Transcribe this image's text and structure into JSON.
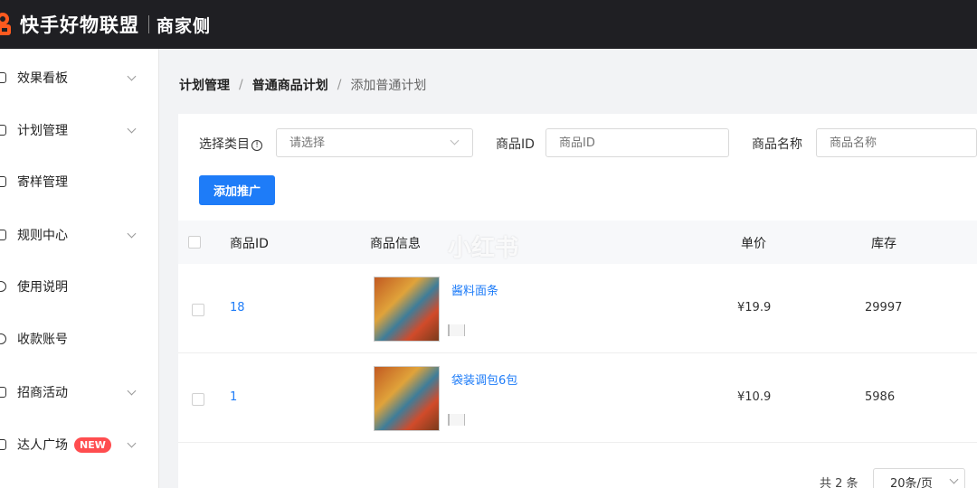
{
  "header": {
    "brand": "快手好物联盟",
    "subtitle": "商家侧"
  },
  "sidebar": {
    "items": [
      {
        "label": "效果看板",
        "icon": "chart-icon"
      },
      {
        "label": "计划管理",
        "icon": "plan-icon"
      },
      {
        "label": "寄样管理",
        "icon": "sample-icon"
      },
      {
        "label": "规则中心",
        "icon": "rules-icon"
      },
      {
        "label": "使用说明",
        "icon": "help-icon"
      },
      {
        "label": "收款账号",
        "icon": "account-icon"
      },
      {
        "label": "招商活动",
        "icon": "activity-icon"
      },
      {
        "label": "达人广场",
        "icon": "creator-icon",
        "badge": "NEW"
      }
    ]
  },
  "breadcrumb": [
    "计划管理",
    "普通商品计划",
    "添加普通计划"
  ],
  "filters": {
    "category_label": "选择类目",
    "category_placeholder": "请选择",
    "product_id_label": "商品ID",
    "product_id_placeholder": "商品ID",
    "product_name_label": "商品名称",
    "product_name_placeholder": "商品名称"
  },
  "add_button": "添加推广",
  "table": {
    "columns": [
      "商品ID",
      "商品信息",
      "单价",
      "库存"
    ],
    "rows": [
      {
        "id": "18",
        "name": "酱料面条",
        "price": "¥19.9",
        "stock": "29997"
      },
      {
        "id": "1",
        "name": "袋装调包6包",
        "price": "¥10.9",
        "stock": "5986"
      }
    ]
  },
  "pagination": {
    "total": "共 2 条",
    "page_size": "20条/页"
  },
  "watermark": "小红书",
  "colors": {
    "topbar": "#1f1f23",
    "primary": "#1e7cf8",
    "new_badge": "#ff4d4f"
  }
}
